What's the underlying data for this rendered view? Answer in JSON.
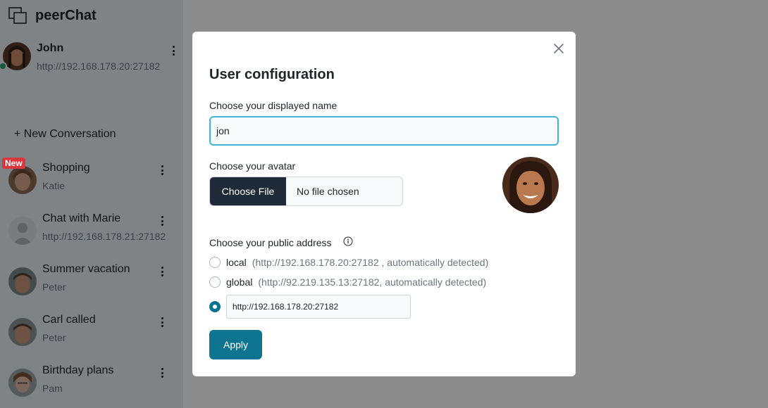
{
  "app": {
    "title": "peerChat"
  },
  "me": {
    "name": "John",
    "address": "http://192.168.178.20:27182",
    "status": "online"
  },
  "sidebar": {
    "new_conversation_label": "+ New Conversation",
    "conversations": [
      {
        "title": "Shopping",
        "subtitle": "Katie",
        "badge": "New"
      },
      {
        "title": "Chat with Marie",
        "subtitle": "http://192.168.178.21:27182",
        "badge": ""
      },
      {
        "title": "Summer vacation",
        "subtitle": "Peter",
        "badge": ""
      },
      {
        "title": "Carl called",
        "subtitle": "Peter",
        "badge": ""
      },
      {
        "title": "Birthday plans",
        "subtitle": "Pam",
        "badge": ""
      }
    ]
  },
  "modal": {
    "title": "User configuration",
    "name_label": "Choose your displayed name",
    "name_value": "jon",
    "avatar_label": "Choose your avatar",
    "file_button": "Choose File",
    "file_status": "No file chosen",
    "address_label": "Choose your public address",
    "options": [
      {
        "label": "local",
        "detail": "(http://192.168.178.20:27182 , automatically detected)",
        "checked": false
      },
      {
        "label": "global",
        "detail": "(http://92.219.135.13:27182, automatically detected)",
        "checked": false
      },
      {
        "label": "",
        "detail": "",
        "checked": true
      }
    ],
    "custom_address_value": "http://192.168.178.20:27182",
    "apply_label": "Apply"
  },
  "colors": {
    "accent": "#0e7490",
    "badge": "#d9363e",
    "online": "#20a070",
    "sidebar_bg": "#e9eef4",
    "focus": "#3fb6d3"
  },
  "icons": [
    "chat-windows-icon",
    "kebab-menu-icon",
    "close-icon",
    "info-icon",
    "avatar-placeholder-icon"
  ]
}
